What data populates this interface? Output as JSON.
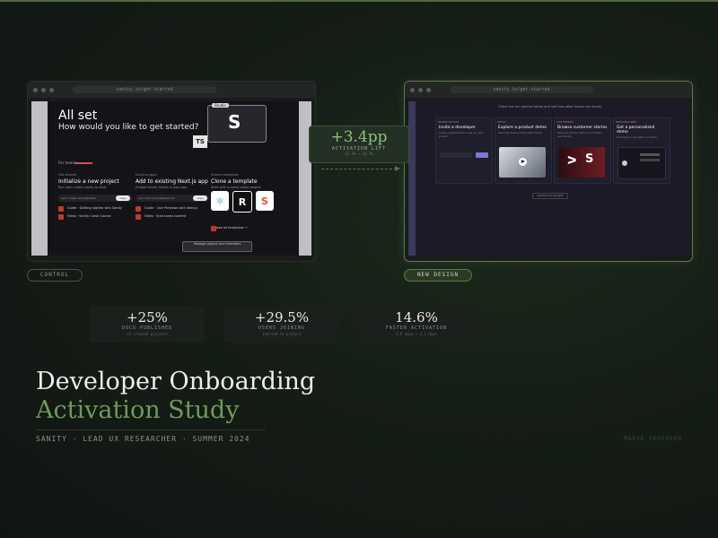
{
  "control": {
    "url": "sanity.io/get-started",
    "label": "CONTROL",
    "screen": {
      "title": "All set",
      "subtitle": "How would you like to get started?",
      "s_badge": "Studio",
      "ts_badge": "TS",
      "tab": "For teams",
      "columns": [
        {
          "cap": "Get started",
          "heading": "Initialize a new project",
          "desc": "Run npm create sanity to start",
          "input": "npm create sanity@latest",
          "button": "Copy",
          "items": [
            "Guide · Getting started with Sanity",
            "Video · Sanity Crash Course"
          ]
        },
        {
          "cap": "Existing apps",
          "heading": "Add to existing Next.js app",
          "desc": "Embed Sanity Studio in your app",
          "input": "npx next-sanity@latest init",
          "button": "Copy",
          "items": [
            "Guide · Live Previews with Next.js",
            "Video · Structured content"
          ]
        },
        {
          "cap": "Starter templates",
          "heading": "Clone a template",
          "desc": "Start with a ready-made project",
          "input": "",
          "button": "",
          "items": [
            "Browse all templates →"
          ]
        }
      ],
      "manage": "Manage project and members"
    }
  },
  "new_design": {
    "url": "sanity.io/get-started",
    "label": "NEW DESIGN",
    "screen": {
      "top_text": "Check out our product demo and see how other teams use Sanity",
      "cards": [
        {
          "tag": "INTRODUCTION",
          "title": "Invite a developer",
          "desc": "Invite a teammate to set up your project"
        },
        {
          "tag": "DEMO",
          "title": "Explore a product demo",
          "desc": "See how teams build with Sanity"
        },
        {
          "tag": "CUSTOMERS",
          "title": "Browse customer stories",
          "desc": "See how Puma, Figma and others use Sanity"
        },
        {
          "tag": "PERSONALIZED",
          "title": "Get a personalized demo",
          "desc": "Schedule a call with our team"
        }
      ],
      "footer_button": "Continue to project"
    }
  },
  "lift": {
    "value": "+3.4pp",
    "label": "ACTIVATION LIFT",
    "range": "11.3% → 14.7%"
  },
  "stats": [
    {
      "value": "+25%",
      "label": "DOCS PUBLISHED",
      "sub": "in created projects"
    },
    {
      "value": "+29.5%",
      "label": "USERS JOINING",
      "sub": "invited to project"
    },
    {
      "value": "14.6%",
      "label": "FASTER ACTIVATION",
      "sub": "4.8 days → 4.1 days"
    }
  ],
  "title": {
    "line1": "Developer Onboarding",
    "line2": "Activation Study"
  },
  "meta": "SANITY · LEAD UX RESEARCHER · SUMMER 2024",
  "author": "MARIE PEDERSON",
  "colors": {
    "accent": "#6f9a56",
    "lift": "#8cc17a",
    "background": "#151d16"
  }
}
